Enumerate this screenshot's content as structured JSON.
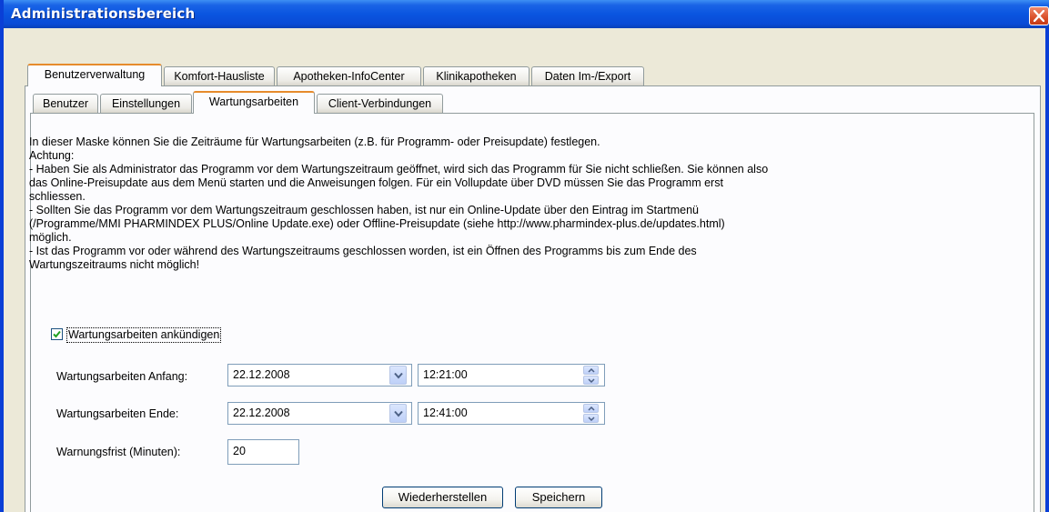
{
  "window": {
    "title": "Administrationsbereich"
  },
  "main_tabs": [
    {
      "label": "Benutzerverwaltung",
      "active": true
    },
    {
      "label": "Komfort-Hausliste",
      "active": false
    },
    {
      "label": "Apotheken-InfoCenter",
      "active": false
    },
    {
      "label": "Klinikapotheken",
      "active": false
    },
    {
      "label": "Daten Im-/Export",
      "active": false
    }
  ],
  "sub_tabs": [
    {
      "label": "Benutzer",
      "active": false
    },
    {
      "label": "Einstellungen",
      "active": false
    },
    {
      "label": "Wartungsarbeiten",
      "active": true
    },
    {
      "label": "Client-Verbindungen",
      "active": false
    }
  ],
  "info_lines": [
    "In dieser Maske können Sie die Zeiträume für Wartungsarbeiten (z.B. für Programm- oder Preisupdate) festlegen.",
    "Achtung:",
    "- Haben Sie als Administrator das Programm vor dem Wartungszeitraum geöffnet, wird sich das Programm für Sie nicht schließen. Sie können also",
    "das Online-Preisupdate aus dem Menü starten und die Anweisungen folgen. Für ein Vollupdate über DVD müssen Sie das Programm erst",
    "schliessen.",
    "- Sollten Sie das Programm vor dem Wartungszeitraum geschlossen haben, ist nur ein Online-Update über den Eintrag im Startmenü",
    "(/Programme/MMI PHARMINDEX PLUS/Online Update.exe) oder Offline-Preisupdate (siehe http://www.pharmindex-plus.de/updates.html)",
    "möglich.",
    "- Ist das Programm vor oder während des Wartungszeitraums geschlossen worden, ist ein Öffnen des Programms bis zum Ende des",
    "Wartungszeitraums nicht möglich!"
  ],
  "announce": {
    "label": "Wartungsarbeiten ankündigen",
    "checked": true
  },
  "start": {
    "label": "Wartungsarbeiten Anfang:",
    "date": "22.12.2008",
    "time": "12:21:00"
  },
  "end": {
    "label": "Wartungsarbeiten Ende:",
    "date": "22.12.2008",
    "time": "12:41:00"
  },
  "warning": {
    "label": "Warnungsfrist (Minuten):",
    "value": "20"
  },
  "buttons": {
    "restore": "Wiederherstellen",
    "save": "Speichern"
  },
  "colors": {
    "titlebar": "#0a55e0",
    "active_tab_accent": "#e68b2c",
    "close": "#d9502a",
    "check": "#21a121"
  }
}
